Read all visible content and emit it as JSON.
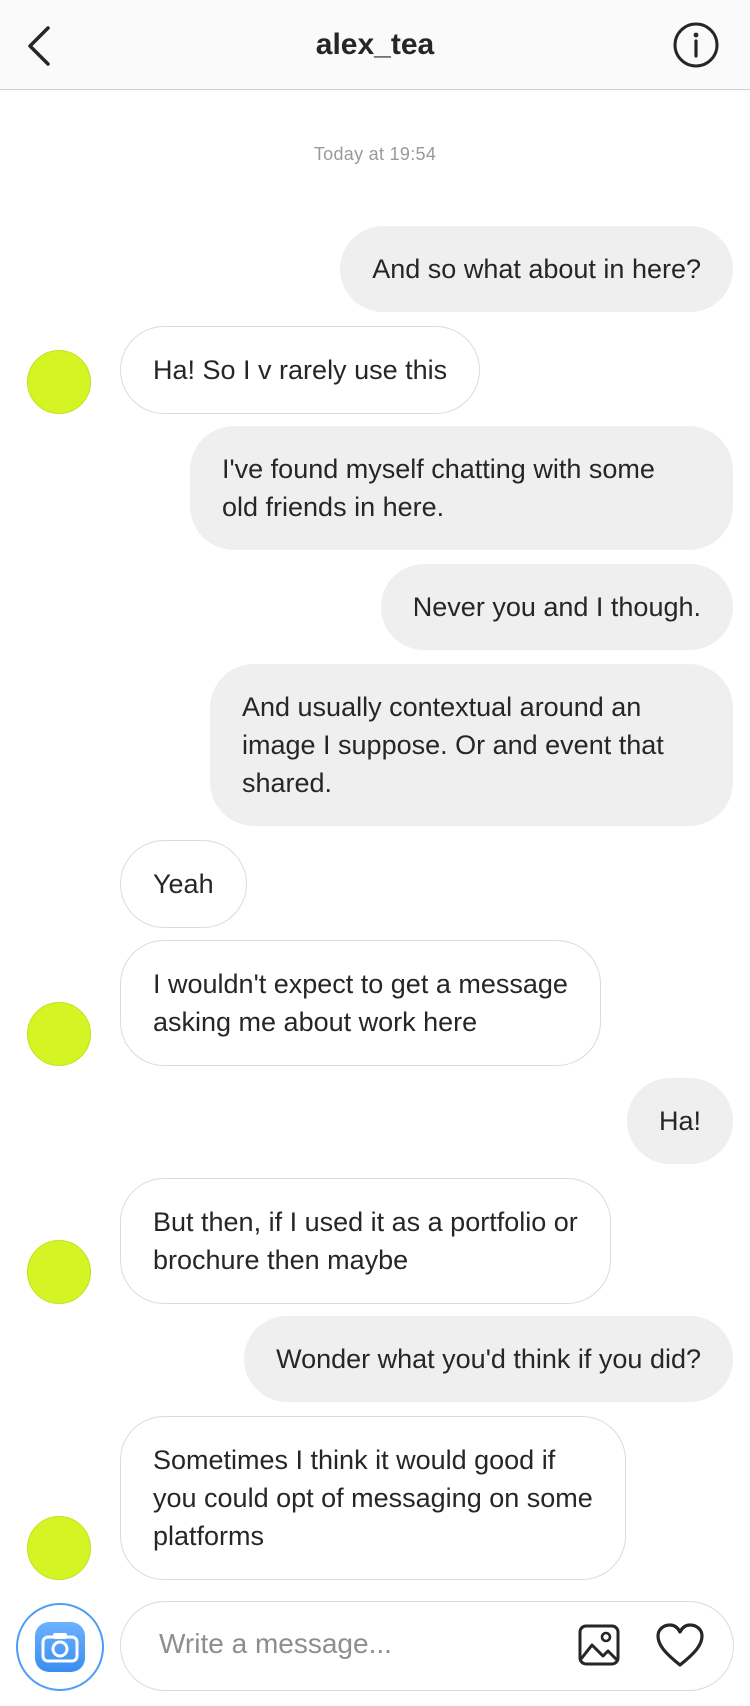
{
  "header": {
    "title": "alex_tea",
    "back_icon": "chevron-left-icon",
    "info_icon": "info-icon"
  },
  "timestamp": "Today at 19:54",
  "messages": [
    {
      "from": "me",
      "text": "And so what about in here?"
    },
    {
      "from": "them",
      "text": "Ha! So I v rarely use this"
    },
    {
      "from": "me",
      "text": "I've found myself chatting with some\nold friends in here."
    },
    {
      "from": "me",
      "text": "Never you and I though."
    },
    {
      "from": "me",
      "text": "And usually contextual around an\nimage I suppose. Or and event that\nshared."
    },
    {
      "from": "them",
      "text": "Yeah"
    },
    {
      "from": "them",
      "text": "I wouldn't expect to get a message\nasking me about work here"
    },
    {
      "from": "me",
      "text": "Ha!"
    },
    {
      "from": "them",
      "text": "But then, if I used it as a portfolio or\nbrochure then maybe"
    },
    {
      "from": "me",
      "text": "Wonder what you'd think if you did?"
    },
    {
      "from": "them",
      "text": "Sometimes I think it would good if\nyou could opt of messaging on some\nplatforms"
    }
  ],
  "composer": {
    "placeholder": "Write a message...",
    "camera_icon": "camera-icon",
    "gallery_icon": "image-icon",
    "like_icon": "heart-icon"
  },
  "colors": {
    "avatar": "#d4f423",
    "sent_bubble": "#efefef",
    "received_border": "#dbdbdb",
    "camera_accent": "#3a8df0"
  }
}
